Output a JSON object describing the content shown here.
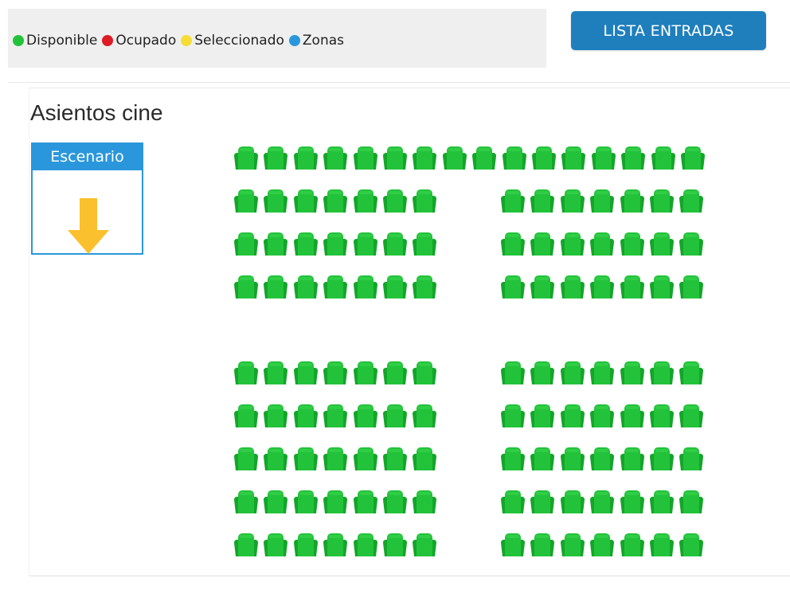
{
  "legend": {
    "items": [
      {
        "label": "Disponible",
        "color": "#22c33a"
      },
      {
        "label": "Ocupado",
        "color": "#dd1c25"
      },
      {
        "label": "Seleccionado",
        "color": "#f5dd36"
      },
      {
        "label": "Zonas",
        "color": "#2a97dc"
      }
    ]
  },
  "toolbar": {
    "list_button_label": "LISTA ENTRADAS"
  },
  "main": {
    "title": "Asientos cine"
  },
  "stage": {
    "label": "Escenario",
    "icon": "arrow-down-icon",
    "arrow_color": "#fbc02d"
  },
  "seat_status_default": "Disponible",
  "seat_color": "#22c33a",
  "seat_map": {
    "rows": [
      {
        "row": 1,
        "left_block_seats": 16,
        "right_block_seats": 0
      },
      {
        "row": 2,
        "left_block_seats": 7,
        "right_block_seats": 7
      },
      {
        "row": 3,
        "left_block_seats": 7,
        "right_block_seats": 7
      },
      {
        "row": 4,
        "left_block_seats": 7,
        "right_block_seats": 7
      },
      {
        "row": 5,
        "left_block_seats": 7,
        "right_block_seats": 7
      },
      {
        "row": 6,
        "left_block_seats": 7,
        "right_block_seats": 7
      },
      {
        "row": 7,
        "left_block_seats": 7,
        "right_block_seats": 7
      },
      {
        "row": 8,
        "left_block_seats": 7,
        "right_block_seats": 7
      },
      {
        "row": 9,
        "left_block_seats": 7,
        "right_block_seats": 7
      }
    ]
  }
}
